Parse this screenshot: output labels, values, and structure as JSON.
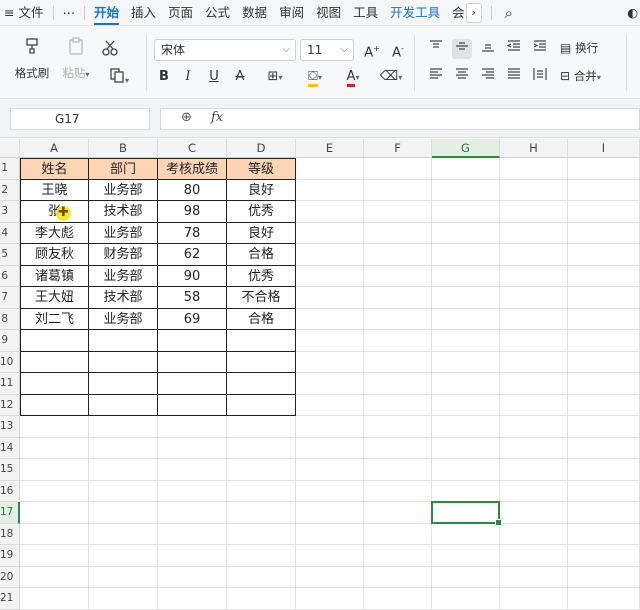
{
  "menu": {
    "hamburger_icon": "≡",
    "file": "文件",
    "more": "⋯",
    "tabs": [
      "开始",
      "插入",
      "页面",
      "公式",
      "数据",
      "审阅",
      "视图",
      "工具",
      "开发工具",
      "会"
    ],
    "active_tab": "开始",
    "next_icon": "›",
    "search_icon": "⌕",
    "extra_icon": "◐"
  },
  "ribbon": {
    "format_painter": "格式刷",
    "paste": "粘贴",
    "font_name": "宋体",
    "font_size": "11",
    "bold": "B",
    "italic": "I",
    "underline": "U",
    "strike": "A",
    "wrap_text": "换行",
    "merge": "合并"
  },
  "formula_bar": {
    "name_box": "G17",
    "fx": "fx",
    "formula": ""
  },
  "columns": [
    "A",
    "B",
    "C",
    "D",
    "E",
    "F",
    "G",
    "H",
    "I"
  ],
  "selected_column": "G",
  "rows": [
    "1",
    "2",
    "3",
    "4",
    "5",
    "6",
    "7",
    "8",
    "9",
    "10",
    "11",
    "12",
    "13",
    "14",
    "15",
    "16",
    "17",
    "18",
    "19",
    "20",
    "21"
  ],
  "selected_row": "17",
  "table": {
    "headers": [
      "姓名",
      "部门",
      "考核成绩",
      "等级"
    ],
    "header_color": "#FBD5B5",
    "rows": [
      [
        "王晓",
        "业务部",
        "80",
        "良好"
      ],
      [
        "张",
        "技术部",
        "98",
        "优秀"
      ],
      [
        "李大彪",
        "业务部",
        "78",
        "良好"
      ],
      [
        "顾友秋",
        "财务部",
        "62",
        "合格"
      ],
      [
        "诸葛镇",
        "业务部",
        "90",
        "优秀"
      ],
      [
        "王大妞",
        "技术部",
        "58",
        "不合格"
      ],
      [
        "刘二飞",
        "业务部",
        "69",
        "合格"
      ],
      [
        "",
        "",
        "",
        ""
      ],
      [
        "",
        "",
        "",
        ""
      ],
      [
        "",
        "",
        "",
        ""
      ],
      [
        "",
        "",
        "",
        ""
      ]
    ]
  },
  "cursor_glyph": "✚"
}
